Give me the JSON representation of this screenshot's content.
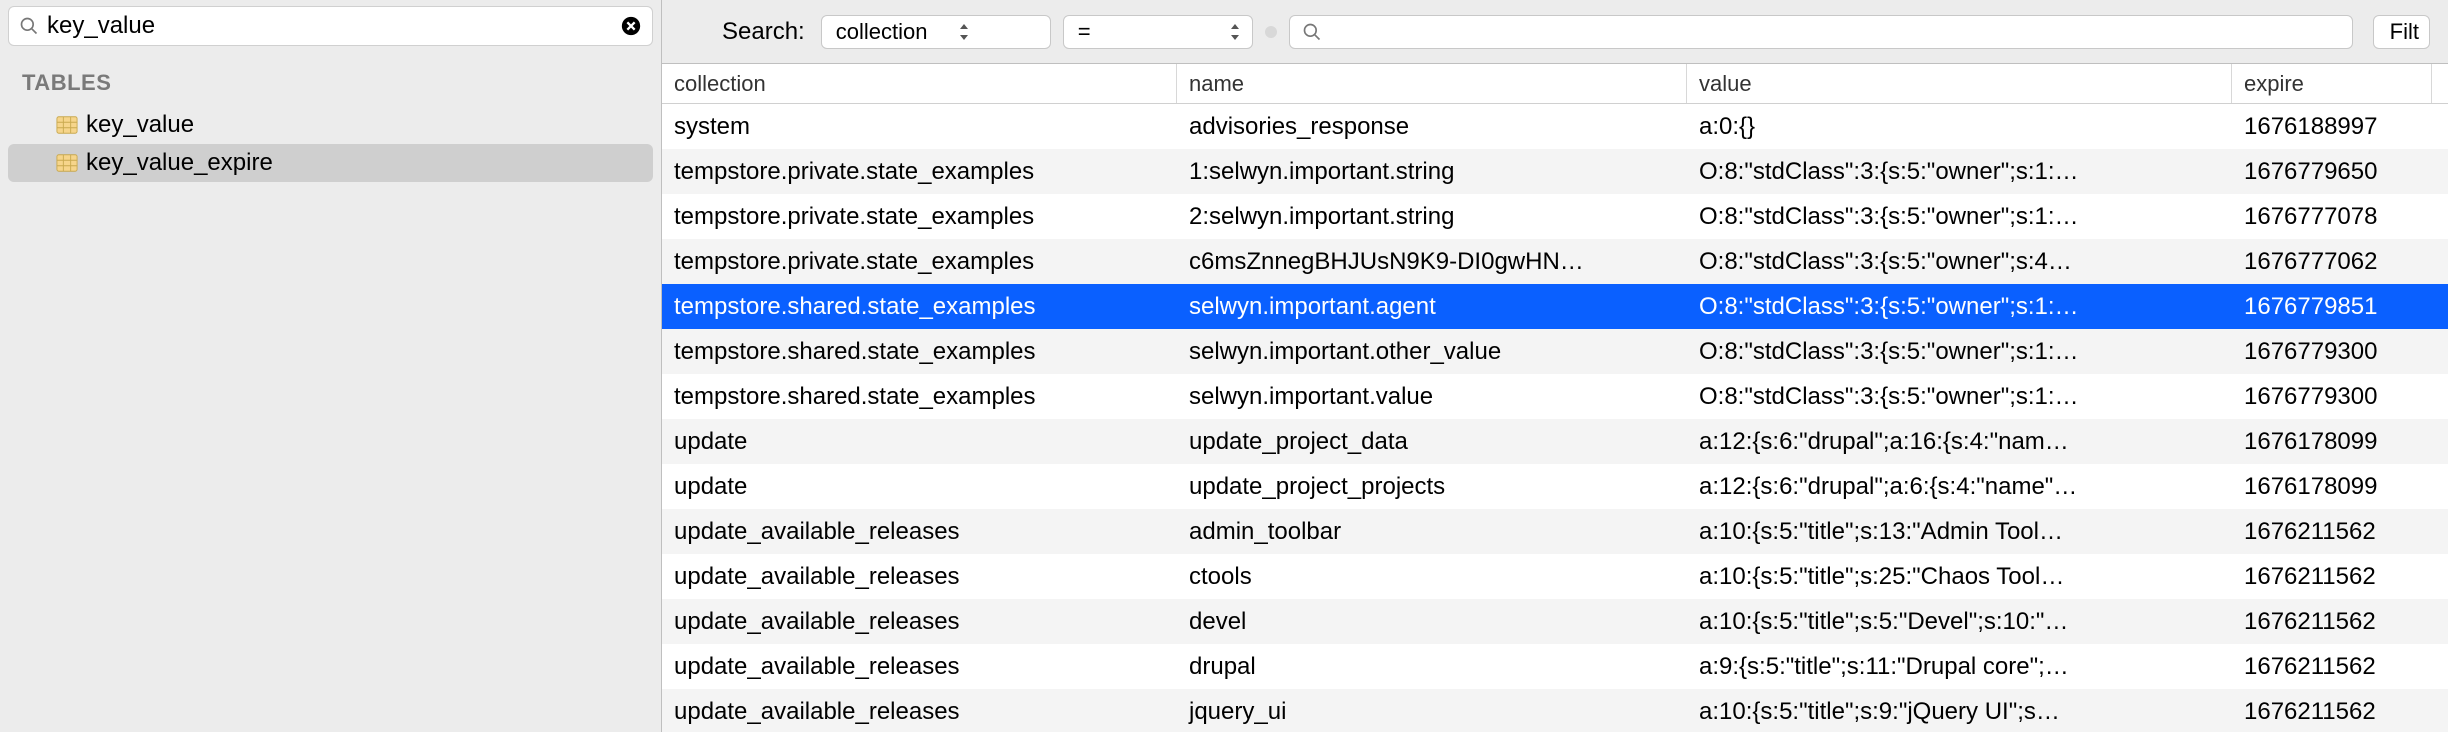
{
  "sidebar": {
    "search_value": "key_value",
    "tables_header": "TABLES",
    "items": [
      {
        "name": "key_value",
        "selected": false
      },
      {
        "name": "key_value_expire",
        "selected": true
      }
    ]
  },
  "toolbar": {
    "search_label": "Search:",
    "field_select": "collection",
    "op_select": "=",
    "value_input": "",
    "filter_button": "Filt"
  },
  "columns": [
    "collection",
    "name",
    "value",
    "expire"
  ],
  "rows": [
    {
      "collection": "system",
      "name": "advisories_response",
      "value": "a:0:{}",
      "expire": "1676188997",
      "sel": false
    },
    {
      "collection": "tempstore.private.state_examples",
      "name": "1:selwyn.important.string",
      "value": "O:8:\"stdClass\":3:{s:5:\"owner\";s:1:…",
      "expire": "1676779650",
      "sel": false
    },
    {
      "collection": "tempstore.private.state_examples",
      "name": "2:selwyn.important.string",
      "value": "O:8:\"stdClass\":3:{s:5:\"owner\";s:1:…",
      "expire": "1676777078",
      "sel": false
    },
    {
      "collection": "tempstore.private.state_examples",
      "name": "c6msZnnegBHJUsN9K9-DI0gwHN…",
      "value": "O:8:\"stdClass\":3:{s:5:\"owner\";s:4…",
      "expire": "1676777062",
      "sel": false
    },
    {
      "collection": "tempstore.shared.state_examples",
      "name": "selwyn.important.agent",
      "value": "O:8:\"stdClass\":3:{s:5:\"owner\";s:1:…",
      "expire": "1676779851",
      "sel": true
    },
    {
      "collection": "tempstore.shared.state_examples",
      "name": "selwyn.important.other_value",
      "value": "O:8:\"stdClass\":3:{s:5:\"owner\";s:1:…",
      "expire": "1676779300",
      "sel": false
    },
    {
      "collection": "tempstore.shared.state_examples",
      "name": "selwyn.important.value",
      "value": "O:8:\"stdClass\":3:{s:5:\"owner\";s:1:…",
      "expire": "1676779300",
      "sel": false
    },
    {
      "collection": "update",
      "name": "update_project_data",
      "value": "a:12:{s:6:\"drupal\";a:16:{s:4:\"nam…",
      "expire": "1676178099",
      "sel": false
    },
    {
      "collection": "update",
      "name": "update_project_projects",
      "value": "a:12:{s:6:\"drupal\";a:6:{s:4:\"name\"…",
      "expire": "1676178099",
      "sel": false
    },
    {
      "collection": "update_available_releases",
      "name": "admin_toolbar",
      "value": "a:10:{s:5:\"title\";s:13:\"Admin Tool…",
      "expire": "1676211562",
      "sel": false
    },
    {
      "collection": "update_available_releases",
      "name": "ctools",
      "value": "a:10:{s:5:\"title\";s:25:\"Chaos Tool…",
      "expire": "1676211562",
      "sel": false
    },
    {
      "collection": "update_available_releases",
      "name": "devel",
      "value": "a:10:{s:5:\"title\";s:5:\"Devel\";s:10:\"…",
      "expire": "1676211562",
      "sel": false
    },
    {
      "collection": "update_available_releases",
      "name": "drupal",
      "value": "a:9:{s:5:\"title\";s:11:\"Drupal core\";…",
      "expire": "1676211562",
      "sel": false
    },
    {
      "collection": "update_available_releases",
      "name": "jquery_ui",
      "value": "a:10:{s:5:\"title\";s:9:\"jQuery UI\";s…",
      "expire": "1676211562",
      "sel": false
    }
  ]
}
